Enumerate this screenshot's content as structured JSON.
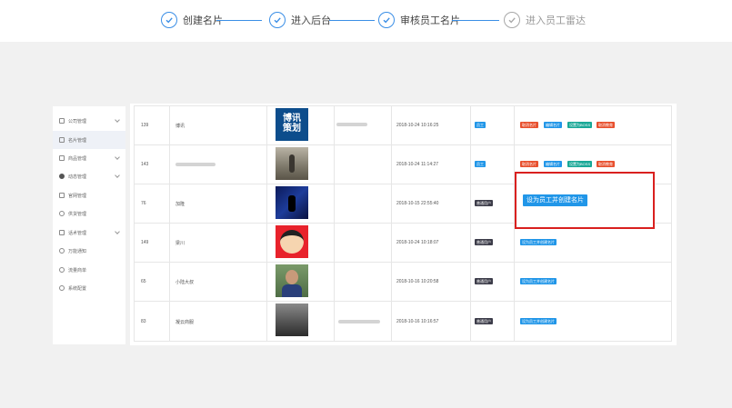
{
  "steps": [
    "创建名片",
    "进入后台",
    "审核员工名片",
    "进入员工雷达"
  ],
  "sidebar": [
    "公司管理",
    "名片管理",
    "商品管理",
    "动态管理",
    "官网管理",
    "供货管理",
    "话术管理",
    "万能通知",
    "流量商单",
    "系统配置"
  ],
  "rows": [
    {
      "id": "139",
      "name": "博讯",
      "time": "2018-10-24 10:16:25",
      "role": "员工",
      "actions": [
        "取消名片",
        "编辑名片",
        "设置为BOSS",
        "取消教育"
      ]
    },
    {
      "id": "143",
      "name": "",
      "time": "2018-10-24 11:14:27",
      "role": "员工",
      "actions": [
        "取消名片",
        "编辑名片",
        "设置为BOSS",
        "取消教育"
      ]
    },
    {
      "id": "76",
      "name": "加隆",
      "time": "2018-10-15 22:55:40",
      "role": "普通用户",
      "actions": []
    },
    {
      "id": "149",
      "name": "梁川",
      "time": "2018-10-24 10:18:07",
      "role": "普通用户",
      "actions": [
        "设为员工并创建名片"
      ]
    },
    {
      "id": "65",
      "name": "小陆大叔",
      "time": "2018-10-16 10:20:58",
      "role": "普通用户",
      "actions": [
        "设为员工并创建名片"
      ]
    },
    {
      "id": "83",
      "name": "凝云商服",
      "time": "2018-10-16 10:16:57",
      "role": "普通用户",
      "actions": [
        "设为员工并创建名片"
      ]
    }
  ],
  "thumb1_text": [
    "博讯",
    "策划"
  ],
  "callout_button": "设为员工并创建名片",
  "colors": {
    "accent": "#3a8ee6",
    "tag_blue": "#2196e8",
    "tag_dark": "#3d3d4a",
    "tag_red": "#e8502e",
    "tag_teal": "#19a897",
    "highlight": "#d9201f"
  }
}
